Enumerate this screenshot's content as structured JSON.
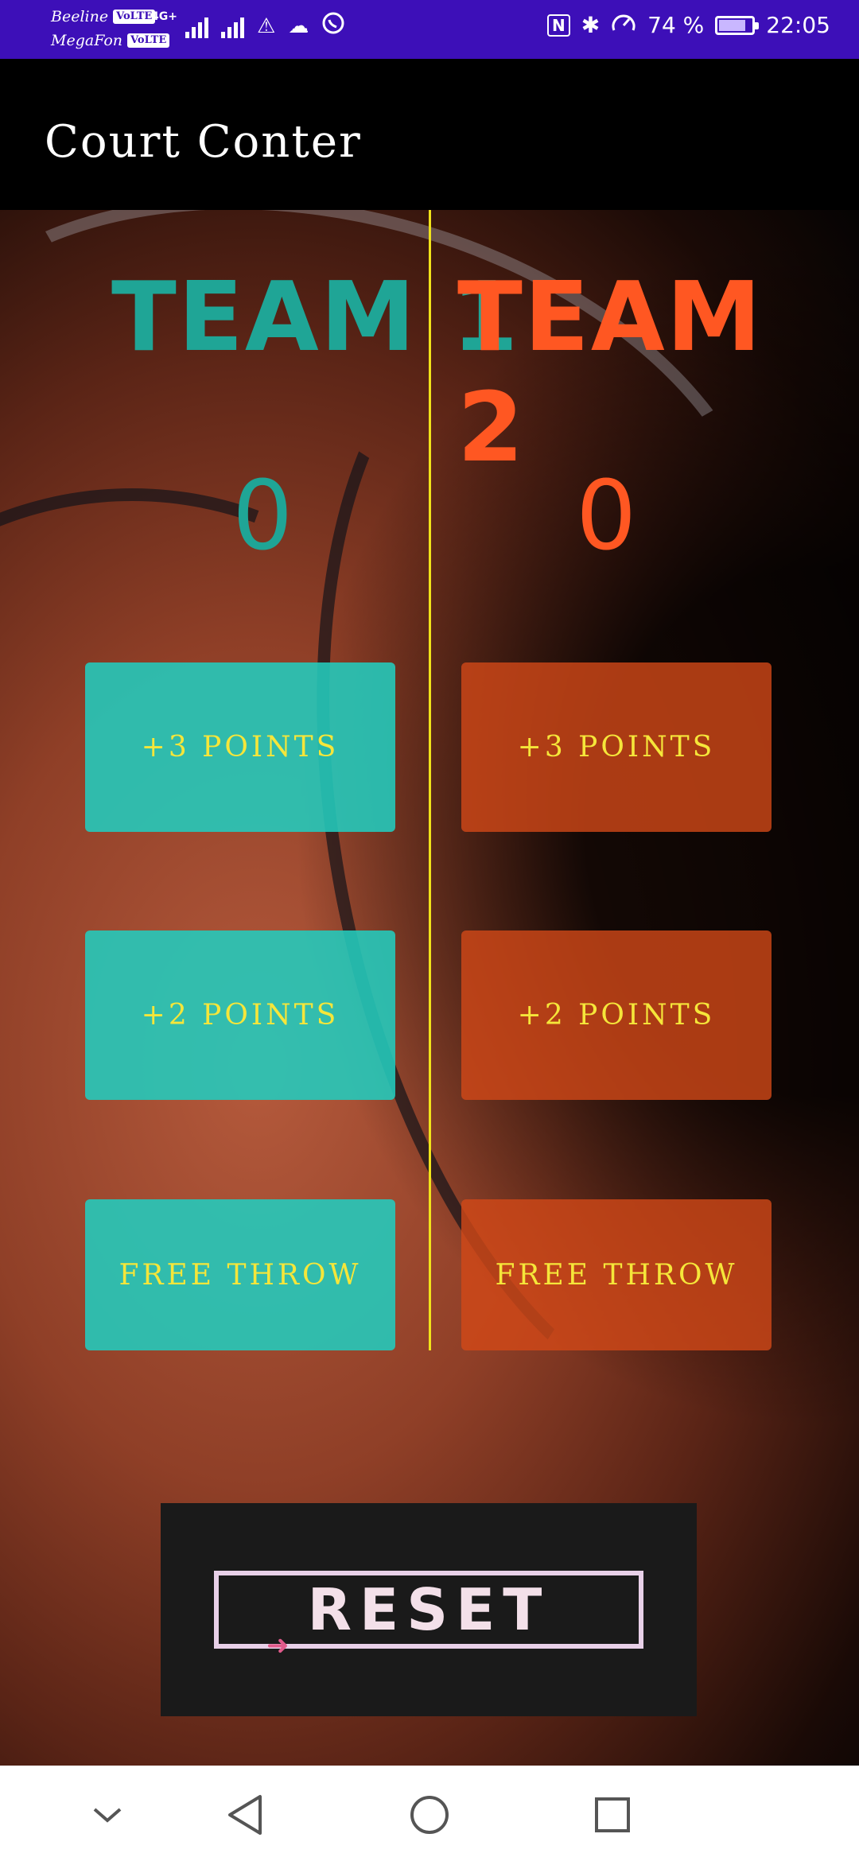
{
  "status_bar": {
    "carrier1": "Beeline",
    "carrier2": "MegaFon",
    "volte": "VoLTE",
    "network": "4G+",
    "battery_percent": "74 %",
    "time": "22:05",
    "battery_level": 0.74
  },
  "app": {
    "title": "Court Conter"
  },
  "team1": {
    "name": "TEAM 1",
    "score": "0",
    "color": "#1fa596",
    "buttons": [
      "+3 POINTS",
      "+2 POINTS",
      "FREE THROW"
    ]
  },
  "team2": {
    "name": "TEAM 2",
    "score": "0",
    "color": "#ff5722",
    "buttons": [
      "+3 POINTS",
      "+2 POINTS",
      "FREE THROW"
    ]
  },
  "reset": {
    "label": "RESET"
  },
  "colors": {
    "button_text": "#f5e63a",
    "divider": "#f0e21a",
    "status_bar": "#3d0fb8"
  },
  "nav": {
    "icons": [
      "chevron-down-icon",
      "back-icon",
      "home-icon",
      "recents-icon"
    ]
  }
}
